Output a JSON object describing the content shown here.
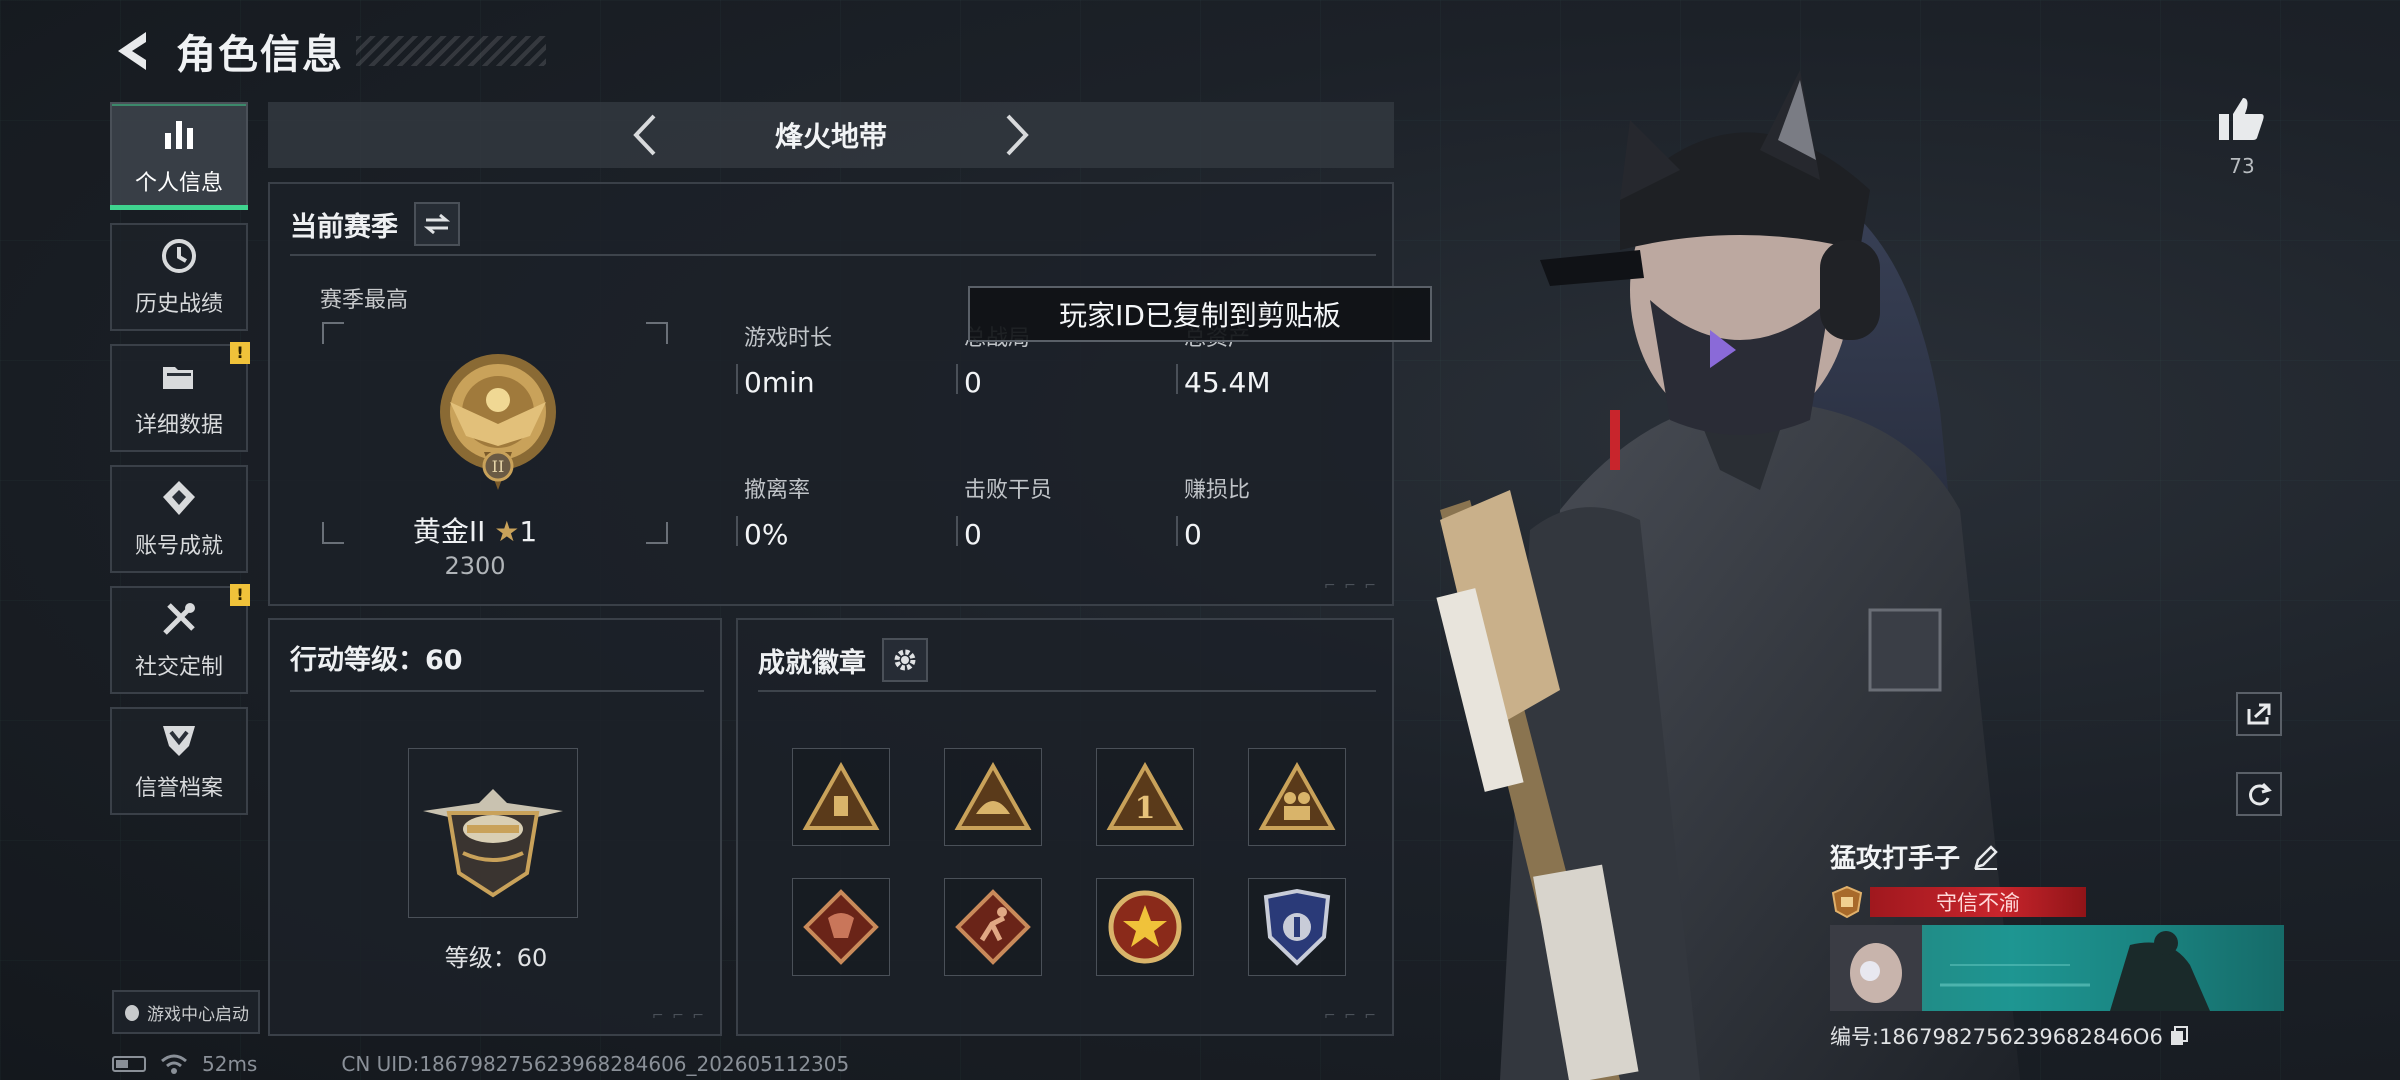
{
  "header": {
    "title": "角色信息"
  },
  "sidebar": {
    "items": [
      {
        "label": "个人信息",
        "icon": "bar-chart-icon",
        "active": true,
        "notification": ""
      },
      {
        "label": "历史战绩",
        "icon": "history-icon",
        "active": false,
        "notification": ""
      },
      {
        "label": "详细数据",
        "icon": "folder-icon",
        "active": false,
        "notification": "!"
      },
      {
        "label": "账号成就",
        "icon": "achievement-icon",
        "active": false,
        "notification": ""
      },
      {
        "label": "社交定制",
        "icon": "tools-icon",
        "active": false,
        "notification": "!"
      },
      {
        "label": "信誉档案",
        "icon": "shield-icon",
        "active": false,
        "notification": ""
      }
    ],
    "launch_label": "游戏中心启动"
  },
  "mode": {
    "title": "烽火地带"
  },
  "season": {
    "title": "当前赛季",
    "best_label": "赛季最高",
    "rank_name": "黄金II",
    "rank_stars": "1",
    "rank_score": "2300",
    "stats": [
      {
        "label": "游戏时长",
        "value": "0min"
      },
      {
        "label": "总战局",
        "value": "0"
      },
      {
        "label": "总资产",
        "value": "45.4M"
      },
      {
        "label": "撤离率",
        "value": "0%"
      },
      {
        "label": "击败干员",
        "value": "0"
      },
      {
        "label": "赚损比",
        "value": "0"
      }
    ]
  },
  "toast": {
    "text": "玩家ID已复制到剪贴板"
  },
  "level": {
    "title": "行动等级：60",
    "text": "等级：60"
  },
  "achievements": {
    "title": "成就徽章"
  },
  "social": {
    "likes": "73"
  },
  "player": {
    "name": "猛攻打手子",
    "credit_tag": "守信不渝",
    "id_text": "编号:1867982756239682846O6"
  },
  "status": {
    "ping": "52ms",
    "uid": "CN UID:186798275623968284606_202605112305"
  },
  "colors": {
    "accent_green": "#3fd48f",
    "notify_yellow": "#f0c23a",
    "credit_red": "#c8252c",
    "banner_teal": "#1e9e9a",
    "gold": "#c9a25a"
  }
}
